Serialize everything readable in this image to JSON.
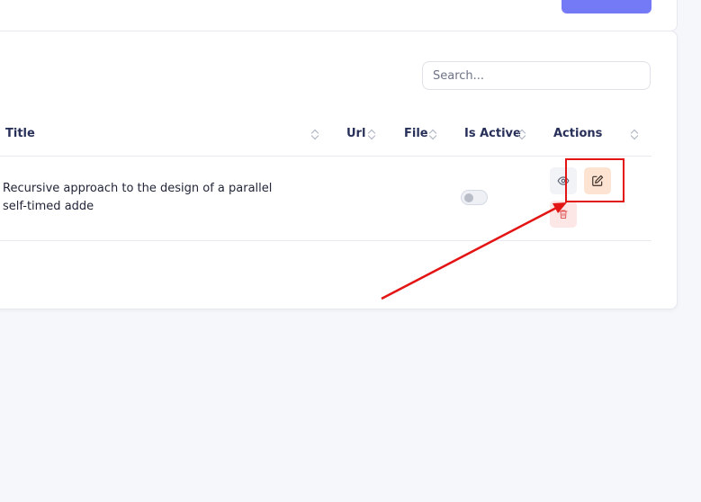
{
  "search": {
    "placeholder": "Search..."
  },
  "table": {
    "columns": [
      "Title",
      "Url",
      "File",
      "Is Active",
      "Actions"
    ],
    "rows": [
      {
        "title": "Recursive approach to the design of a parallel self-timed adde",
        "url": "",
        "file": "",
        "is_active": false
      }
    ]
  },
  "actions": {
    "view_icon": "eye-icon",
    "edit_icon": "edit-icon",
    "delete_icon": "trash-icon"
  },
  "annotation": {
    "color": "#e31414"
  },
  "colors": {
    "primary_button": "#7479f5",
    "edit_bg": "#fde3d1",
    "delete_bg": "#fde6e6"
  }
}
